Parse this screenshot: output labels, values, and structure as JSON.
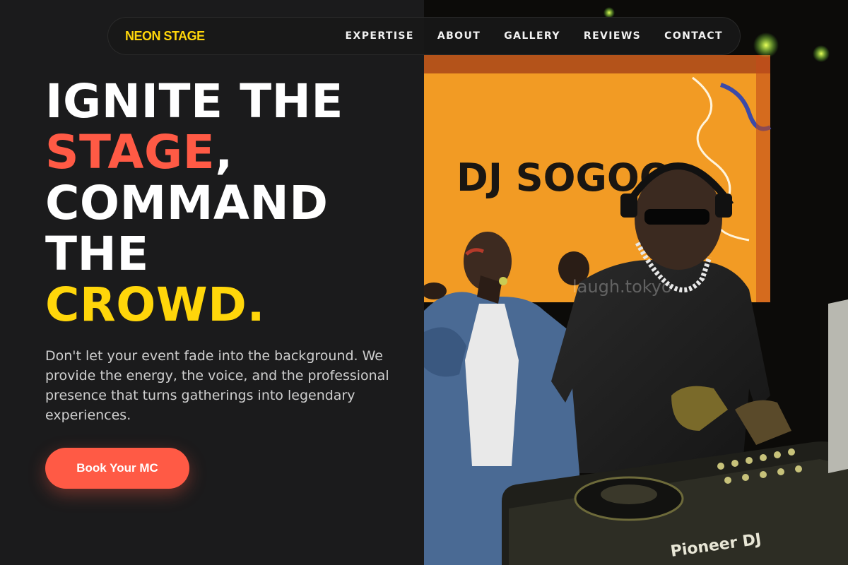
{
  "brand": {
    "logo_text": "NEON STAGE",
    "accent_yellow": "#ffd60a",
    "accent_red": "#ff5a45",
    "background": "#1b1b1c"
  },
  "nav": {
    "links": [
      {
        "label": "EXPERTISE"
      },
      {
        "label": "ABOUT"
      },
      {
        "label": "GALLERY"
      },
      {
        "label": "REVIEWS"
      },
      {
        "label": "CONTACT"
      }
    ]
  },
  "hero": {
    "headline": {
      "line1": "IGNITE THE",
      "line2_highlight": "STAGE",
      "line2_rest": ",",
      "line3": "COMMAND",
      "line4": "THE",
      "line5_highlight": "CROWD."
    },
    "description": "Don't let your event fade into the background. We provide the energy, the voice, and the professional presence that turns gatherings into legendary experiences.",
    "cta_label": "Book Your MC"
  },
  "photo": {
    "screen_text": "DJ SOGOO",
    "watermark": "laugh.tokyo",
    "deck_brand": "Pioneer DJ"
  }
}
